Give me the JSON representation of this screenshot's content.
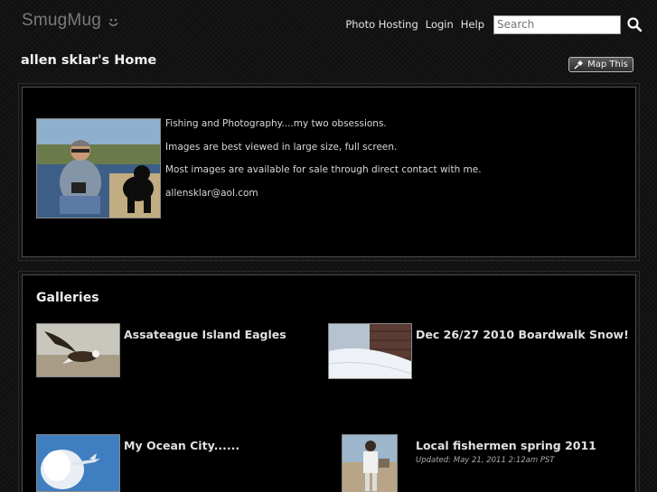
{
  "header": {
    "logo_text": "SmugMug",
    "nav": [
      "Photo Hosting",
      "Login",
      "Help"
    ],
    "search_placeholder": "Search"
  },
  "page": {
    "title": "allen sklar's Home",
    "map_button": "Map This"
  },
  "bio": {
    "lines": [
      "Fishing and Photography....my two obsessions.",
      "Images are best viewed in large size, full screen.",
      "Most images are available for sale through direct contact with me.",
      "allensklar@aol.com"
    ]
  },
  "galleries": {
    "heading": "Galleries",
    "items": [
      {
        "title": "Assateague Island Eagles",
        "updated": ""
      },
      {
        "title": "Dec 26/27 2010 Boardwalk Snow!",
        "updated": ""
      },
      {
        "title": "My Ocean City......",
        "updated": ""
      },
      {
        "title": "Local fishermen spring 2011",
        "updated": "Updated: May 21, 2011 2:12am PST"
      }
    ]
  },
  "icons": {
    "logo_face": "smiley-face-icon",
    "search": "search-icon",
    "map_pin": "pushpin-icon"
  }
}
